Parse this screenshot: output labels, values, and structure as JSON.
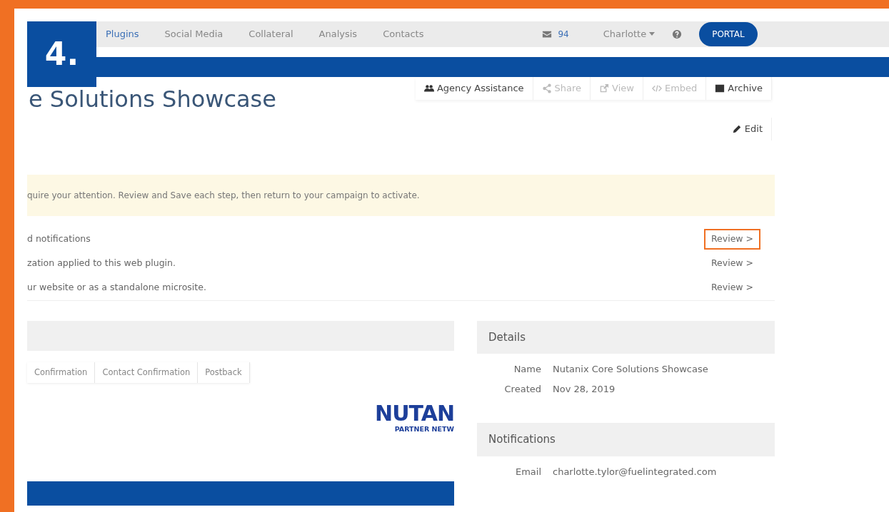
{
  "step_badge": "4.",
  "nav": {
    "items": [
      {
        "label": "Plugins",
        "selected": true
      },
      {
        "label": "Social Media",
        "selected": false
      },
      {
        "label": "Collateral",
        "selected": false
      },
      {
        "label": "Analysis",
        "selected": false
      },
      {
        "label": "Contacts",
        "selected": false
      }
    ],
    "mail_count": "94",
    "user": "Charlotte",
    "portal": "PORTAL"
  },
  "page_title": "e Solutions Showcase",
  "actions": [
    {
      "label": "Agency Assistance",
      "kind": "users",
      "disabled": false
    },
    {
      "label": "Share",
      "kind": "share",
      "disabled": true
    },
    {
      "label": "View",
      "kind": "external",
      "disabled": true
    },
    {
      "label": "Embed",
      "kind": "code",
      "disabled": true
    },
    {
      "label": "Archive",
      "kind": "archive",
      "disabled": false
    }
  ],
  "edit": "Edit",
  "alert": "quire your attention. Review and Save each step, then return to your campaign to activate.",
  "steps": [
    {
      "text": "d notifications",
      "action": "Review >",
      "highlighted": true
    },
    {
      "text": "zation applied to this web plugin.",
      "action": "Review >",
      "highlighted": false
    },
    {
      "text": "ur website or as a standalone microsite.",
      "action": "Review >",
      "highlighted": false
    }
  ],
  "tabs": [
    "Confirmation",
    "Contact Confirmation",
    "Postback"
  ],
  "logo": {
    "name": "NUTAN",
    "tagline": "PARTNER NETW"
  },
  "details": {
    "title": "Details",
    "rows": [
      {
        "label": "Name",
        "value": "Nutanix Core Solutions Showcase"
      },
      {
        "label": "Created",
        "value": "Nov 28, 2019"
      }
    ]
  },
  "notifications": {
    "title": "Notifications",
    "rows": [
      {
        "label": "Email",
        "value": "charlotte.tylor@fuelintegrated.com"
      }
    ]
  }
}
